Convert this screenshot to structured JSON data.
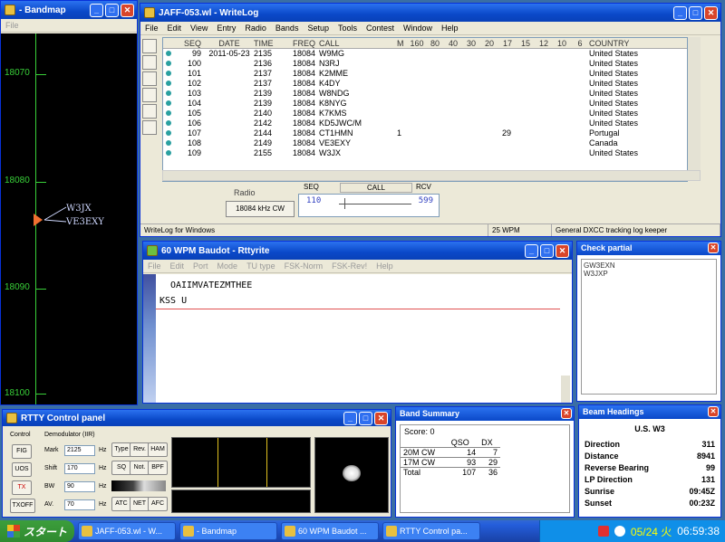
{
  "bandmap": {
    "title": "- Bandmap",
    "menu": [
      "File"
    ],
    "freqs": [
      "18070",
      "18080",
      "18090",
      "18100"
    ],
    "spots": [
      "W3JX",
      "VE3EXY"
    ]
  },
  "writelog": {
    "title": "JAFF-053.wl - WriteLog",
    "menu": [
      "File",
      "Edit",
      "View",
      "Entry",
      "Radio",
      "Bands",
      "Setup",
      "Tools",
      "Contest",
      "Window",
      "Help"
    ],
    "columns": [
      "SEQ",
      "DATE",
      "TIME",
      "FREQ",
      "CALL",
      "M",
      "160",
      "80",
      "40",
      "30",
      "20",
      "17",
      "15",
      "12",
      "10",
      "6",
      "COUNTRY"
    ],
    "rows": [
      {
        "seq": "99",
        "date": "2011-05-23",
        "time": "2135",
        "freq": "18084",
        "call": "W9MG",
        "m": "",
        "b17": "",
        "country": "United States"
      },
      {
        "seq": "100",
        "date": "",
        "time": "2136",
        "freq": "18084",
        "call": "N3RJ",
        "m": "",
        "b17": "",
        "country": "United States"
      },
      {
        "seq": "101",
        "date": "",
        "time": "2137",
        "freq": "18084",
        "call": "K2MME",
        "m": "",
        "b17": "",
        "country": "United States"
      },
      {
        "seq": "102",
        "date": "",
        "time": "2137",
        "freq": "18084",
        "call": "K4DY",
        "m": "",
        "b17": "",
        "country": "United States"
      },
      {
        "seq": "103",
        "date": "",
        "time": "2139",
        "freq": "18084",
        "call": "W8NDG",
        "m": "",
        "b17": "",
        "country": "United States"
      },
      {
        "seq": "104",
        "date": "",
        "time": "2139",
        "freq": "18084",
        "call": "K8NYG",
        "m": "",
        "b17": "",
        "country": "United States"
      },
      {
        "seq": "105",
        "date": "",
        "time": "2140",
        "freq": "18084",
        "call": "K7KMS",
        "m": "",
        "b17": "",
        "country": "United States"
      },
      {
        "seq": "106",
        "date": "",
        "time": "2142",
        "freq": "18084",
        "call": "KD5JWC/M",
        "m": "",
        "b17": "",
        "country": "United States"
      },
      {
        "seq": "107",
        "date": "",
        "time": "2144",
        "freq": "18084",
        "call": "CT1HMN",
        "m": "1",
        "b17": "29",
        "country": "Portugal"
      },
      {
        "seq": "108",
        "date": "",
        "time": "2149",
        "freq": "18084",
        "call": "VE3EXY",
        "m": "",
        "b17": "",
        "country": "Canada"
      },
      {
        "seq": "109",
        "date": "",
        "time": "2155",
        "freq": "18084",
        "call": "W3JX",
        "m": "",
        "b17": "",
        "country": "United States"
      }
    ],
    "entry": {
      "radio_label": "Radio",
      "radio_freq": "18084 kHz CW",
      "seq_label": "SEQ",
      "call_label": "CALL",
      "rcv_label": "RCV",
      "seq_value": "110",
      "rcv_value": "599"
    },
    "status": [
      "WriteLog for Windows",
      "25 WPM",
      "General DXCC tracking log keeper"
    ]
  },
  "rttyrite": {
    "title": "60 WPM Baudot - Rttyrite",
    "menu": [
      "File",
      "Edit",
      "Port",
      "Mode",
      "TU type",
      "FSK-Norm",
      "FSK-Rev!",
      "Help"
    ],
    "line1": "OAIIMVATEZMTHEE",
    "line2": "KSS U"
  },
  "check_partial": {
    "title": "Check partial",
    "items": [
      "GW3EXN",
      "W3JXP"
    ]
  },
  "rtty_control": {
    "title": "RTTY Control panel",
    "control_label": "Control",
    "demod_label": "Demodulator (IIR)",
    "buttons": [
      "FIG",
      "UOS",
      "TX",
      "TXOFF"
    ],
    "mark_label": "Mark",
    "mark_value": "2125",
    "shift_label": "Shift",
    "shift_value": "170",
    "bw_label": "BW",
    "bw_value": "90",
    "av_label": "AV.",
    "av_value": "70",
    "unit": "Hz",
    "side_buttons": [
      "Type",
      "Rev.",
      "HAM",
      "SQ",
      "Not.",
      "BPF",
      "ATC",
      "NET",
      "AFC"
    ]
  },
  "band_summary": {
    "title": "Band Summary",
    "score": "Score: 0",
    "headers": [
      "",
      "QSO",
      "DX"
    ],
    "rows": [
      [
        "20M CW",
        "14",
        "7"
      ],
      [
        "17M CW",
        "93",
        "29"
      ],
      [
        "Total",
        "107",
        "36"
      ]
    ]
  },
  "beam_headings": {
    "title": "Beam Headings",
    "country": "U.S. W3",
    "rows": [
      [
        "Direction",
        "311"
      ],
      [
        "Distance",
        "8941"
      ],
      [
        "Reverse Bearing",
        "99"
      ],
      [
        "LP Direction",
        "131"
      ],
      [
        "Sunrise",
        "09:45Z"
      ],
      [
        "Sunset",
        "00:23Z"
      ]
    ]
  },
  "taskbar": {
    "start": "スタート",
    "tasks": [
      "JAFF-053.wl - W...",
      "- Bandmap",
      "60 WPM Baudot ...",
      "RTTY Control pa..."
    ],
    "date": "05/24 火",
    "time": "06:59:38"
  },
  "colors": {
    "titlebar": "#0a48c8",
    "bandmap_green": "#39d039",
    "desktop": "#3a6ea5"
  }
}
